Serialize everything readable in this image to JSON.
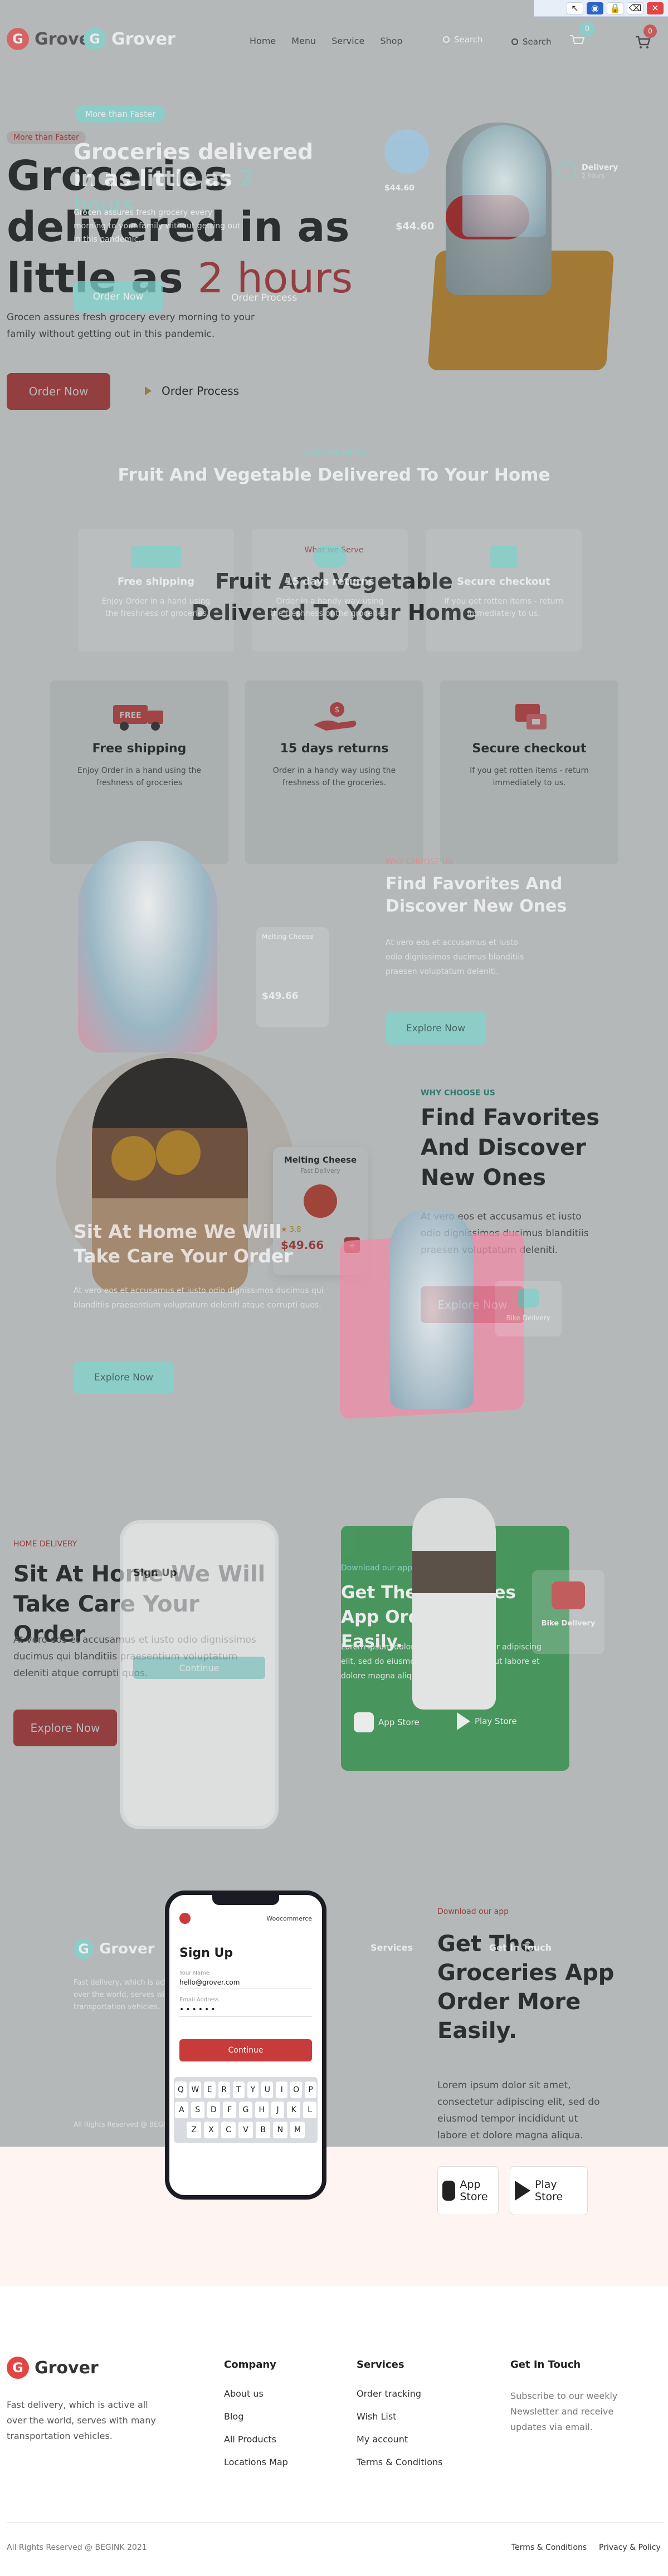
{
  "toolbar": {
    "icons": [
      "cursor-icon",
      "eye-icon",
      "lock-icon",
      "trash-icon",
      "close-icon"
    ]
  },
  "header": {
    "brand": "Grover",
    "nav": [
      "Home",
      "Menu",
      "Service",
      "Shop"
    ],
    "search": "Search",
    "cart_count": "0"
  },
  "hero": {
    "badge": "More than Faster",
    "title_a": "Groceries delivered in as little as ",
    "title_highlight": "2 hours",
    "subtitle": "Grocen assures fresh grocery every morning to your family without getting out in this pandemic.",
    "order_button": "Order Now",
    "process_button": "Order Process",
    "delivery_badge": "Delivery",
    "delivery_time": "2 hours",
    "price": "$44.60",
    "rating_card_title": "Melting Cheese"
  },
  "serve": {
    "kicker": "What we Serve",
    "title": "Fruit And Vegetable Delivered To Your Home",
    "cards": [
      {
        "title": "Free shipping",
        "text": "Enjoy Order in a hand using the freshness of groceries"
      },
      {
        "title": "15 days returns",
        "text": "Order in a handy way using the freshness of the groceries."
      },
      {
        "title": "Secure checkout",
        "text": "If you get rotten items - return immediately to us."
      }
    ]
  },
  "why": {
    "kicker": "WHY CHOOSE US",
    "title": "Find Favorites And Discover New Ones",
    "text": "At vero eos et accusamus et iusto odio dignissimos ducimus blanditiis praesen voluptatum deleniti.",
    "button": "Explore Now",
    "product_card": {
      "name": "Melting Cheese",
      "sub": "Fast Delivery",
      "rating": "3.8",
      "price": "$49.66"
    },
    "bike_delivery": "Bike Delivery"
  },
  "sit": {
    "title": "Sit At Home We Will Take Care Your Order",
    "text": "At vero eos et accusamus et iusto odio dignissimos ducimus qui blanditiis praesentium voluptatum deleniti atque corrupti quos.",
    "button": "Explore Now"
  },
  "delivery": {
    "kicker": "HOME DELIVERY",
    "title": "Sit At Home We Will Take Care Your Order",
    "text": "At vero eos et accusamus et iusto odio dignissimos ducimus qui blanditiis praesentium voluptatum deleniti atque corrupti quos.",
    "button": "Explore Now"
  },
  "app": {
    "kicker": "Download our app",
    "title": "Get The Groceries App Order More Easily.",
    "text": "Lorem ipsum dolor sit amet, consectetur adipiscing elit, sed do eiusmod tempor incididunt ut labore et dolore magna aliqua.",
    "appstore": "App Store",
    "playstore": "Play Store",
    "bike_delivery": "Bike Delivery"
  },
  "signup": {
    "title": "Sign Up",
    "brand": "Woocommerce",
    "name_label": "Your Name",
    "name_value": "hello@grover.com",
    "email_label": "Email Address",
    "password_label": "Password",
    "continue": "Continue",
    "keys": [
      [
        "Q",
        "W",
        "E",
        "R",
        "T",
        "Y",
        "U",
        "I",
        "O",
        "P"
      ],
      [
        "A",
        "S",
        "D",
        "F",
        "G",
        "H",
        "J",
        "K",
        "L"
      ],
      [
        "Z",
        "X",
        "C",
        "V",
        "B",
        "N",
        "M"
      ]
    ]
  },
  "footer": {
    "brand": "Grover",
    "about": "Fast delivery, which is active all over the world, serves with many transportation vehicles.",
    "company_title": "Company",
    "company_links": [
      "About us",
      "Blog",
      "All Products",
      "Locations Map"
    ],
    "services_title": "Services",
    "services_links": [
      "Order tracking",
      "Wish List",
      "My account",
      "Terms & Conditions"
    ],
    "touch_title": "Get In Touch",
    "touch_text": "Subscribe to our weekly Newsletter and receive updates via email.",
    "copyright": "All Rights Reserved @ BEGINK 2021",
    "terms": "Terms & Conditions",
    "privacy": "Privacy & Policy"
  },
  "colors": {
    "accent_red": "#c83b3b",
    "accent_teal": "#7fd6cf",
    "dark": "#1f1f1f"
  }
}
